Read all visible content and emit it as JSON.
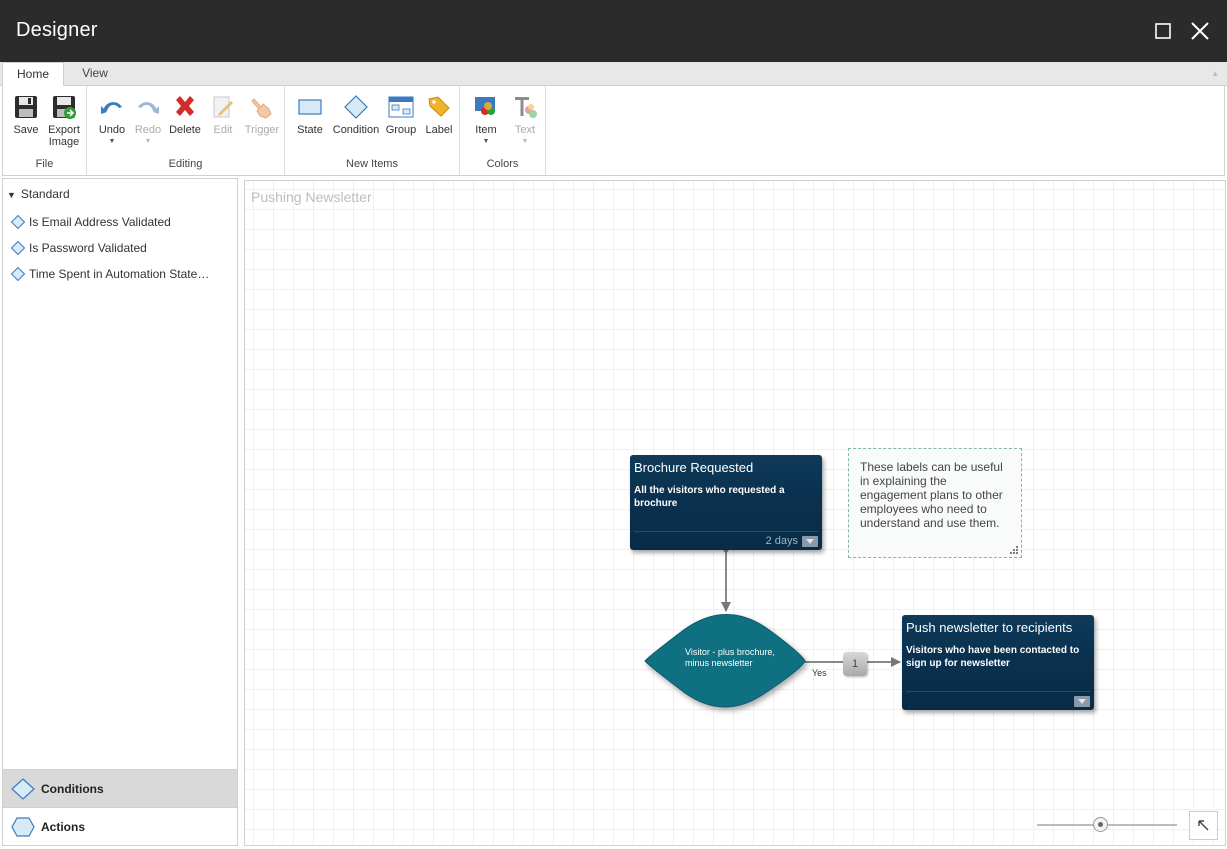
{
  "window": {
    "title": "Designer"
  },
  "ribbon": {
    "tabs": [
      {
        "label": "Home"
      },
      {
        "label": "View"
      }
    ],
    "groups": {
      "file": {
        "label": "File",
        "save": "Save",
        "export_line1": "Export",
        "export_line2": "Image"
      },
      "editing": {
        "label": "Editing",
        "undo": "Undo",
        "redo": "Redo",
        "delete": "Delete",
        "edit": "Edit",
        "trigger": "Trigger"
      },
      "new_items": {
        "label": "New Items",
        "state": "State",
        "condition": "Condition",
        "group": "Group",
        "label_btn": "Label"
      },
      "colors": {
        "label": "Colors",
        "item": "Item",
        "text": "Text"
      }
    }
  },
  "left_panel": {
    "tree_header": "Standard",
    "items": [
      {
        "label": "Is Email Address Validated"
      },
      {
        "label": "Is Password Validated"
      },
      {
        "label": "Time Spent in Automation State…"
      }
    ],
    "tabs": [
      {
        "label": "Conditions",
        "active": true
      },
      {
        "label": "Actions",
        "active": false
      }
    ]
  },
  "canvas": {
    "title": "Pushing Newsletter",
    "state1": {
      "title": "Brochure Requested",
      "description": "All the visitors who requested a brochure",
      "duration": "2 days"
    },
    "note": {
      "text": "These labels can be useful in explaining the engagement plans to other employees who need to understand and use them."
    },
    "condition": {
      "text": "Visitor - plus brochure, minus newsletter",
      "branch_label": "Yes",
      "branch_count": "1"
    },
    "state2": {
      "title": "Push newsletter to recipients",
      "description": "Visitors who have been contacted to sign up for newsletter"
    }
  },
  "zoom": {
    "level": 0.45
  },
  "colors": {
    "titlebar": "#2b2b2b",
    "state_fill": "#0a3150",
    "condition_fill": "#0e7080",
    "note_border": "#7fb9a9"
  }
}
